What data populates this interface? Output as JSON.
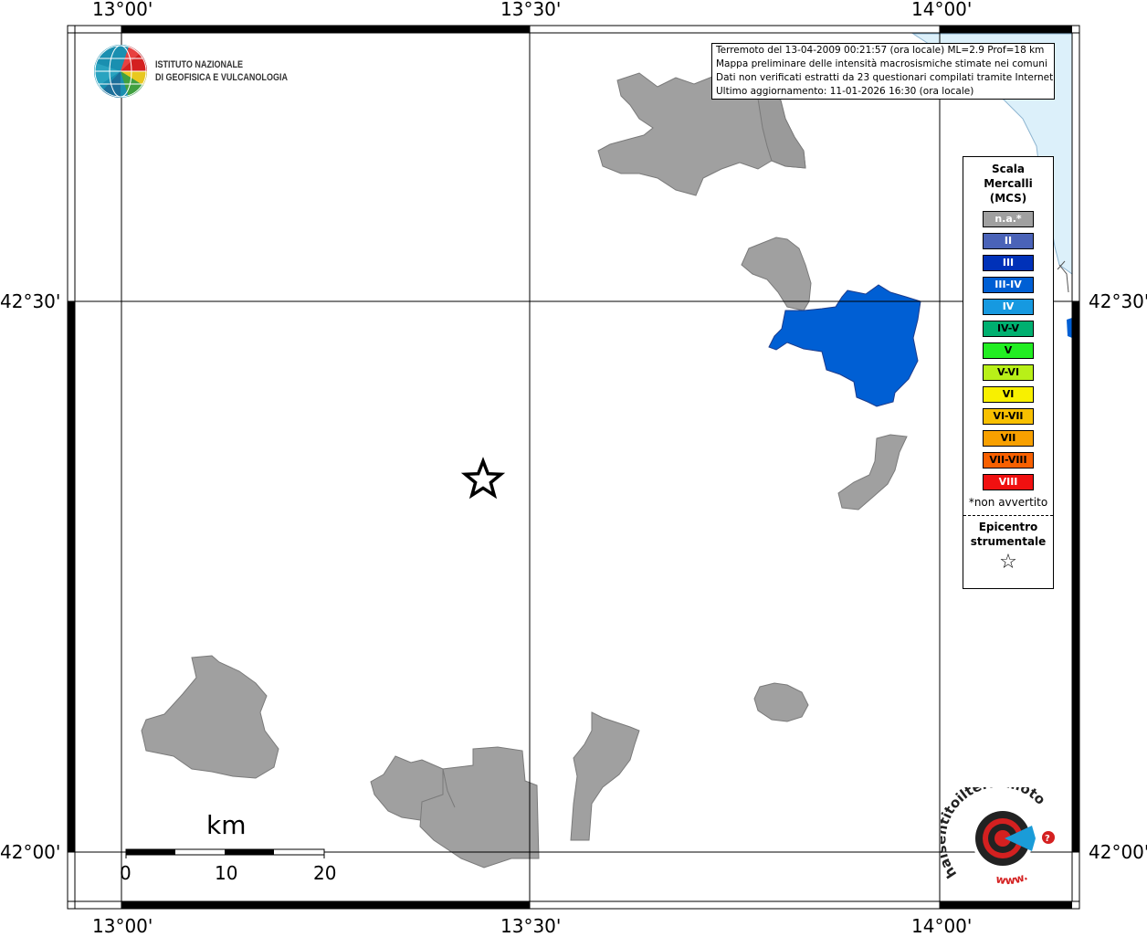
{
  "map": {
    "ticks_top": [
      "13°00'",
      "13°30'",
      "14°00'"
    ],
    "ticks_bottom": [
      "13°00'",
      "13°30'",
      "14°00'"
    ],
    "ticks_left": [
      "42°30'",
      "42°00'"
    ],
    "ticks_right": [
      "42°30'",
      "42°00'"
    ]
  },
  "logo": {
    "line1": "ISTITUTO NAZIONALE",
    "line2": "DI GEOFISICA E VULCANOLOGIA"
  },
  "info": {
    "line1": "Terremoto del 13-04-2009 00:21:57 (ora locale) ML=2.9 Prof=18 km",
    "line2": "Mappa preliminare delle intensità macrosismiche stimate nei comuni",
    "line3": "Dati non verificati estratti da 23 questionari compilati tramite Internet.",
    "line4": "Ultimo aggiornamento: 11-01-2026 16:30 (ora locale)"
  },
  "legend": {
    "title1": "Scala",
    "title2": "Mercalli",
    "title3": "(MCS)",
    "items": [
      {
        "label": "n.a.*",
        "color": "#a0a0a0"
      },
      {
        "label": "II",
        "color": "#4a63b8"
      },
      {
        "label": "III",
        "color": "#0031b8"
      },
      {
        "label": "III-IV",
        "color": "#005fd4"
      },
      {
        "label": "IV",
        "color": "#1699e0"
      },
      {
        "label": "IV-V",
        "color": "#00b070"
      },
      {
        "label": "V",
        "color": "#22ee22"
      },
      {
        "label": "V-VI",
        "color": "#b8f018"
      },
      {
        "label": "VI",
        "color": "#f8f000"
      },
      {
        "label": "VI-VII",
        "color": "#f8c000"
      },
      {
        "label": "VII",
        "color": "#f8a000"
      },
      {
        "label": "VII-VIII",
        "color": "#f86000"
      },
      {
        "label": "VIII",
        "color": "#f01010"
      }
    ],
    "note": "*non avvertito",
    "epicenter1": "Epicentro",
    "epicenter2": "strumentale",
    "star": "☆"
  },
  "scale": {
    "unit": "km",
    "labels": [
      "0",
      "10",
      "20"
    ]
  },
  "site_logo": {
    "text": "haisentitoilterremoto.it",
    "www": "www."
  },
  "colors": {
    "not_felt": "#a0a0a0",
    "intensity_3_4": "#005fd4",
    "sea": "#dcf0fa"
  }
}
